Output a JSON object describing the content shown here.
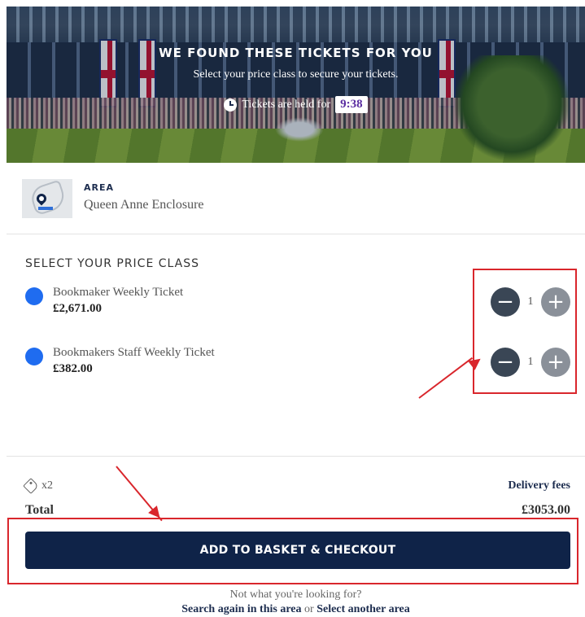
{
  "hero": {
    "title": "WE FOUND THESE TICKETS FOR YOU",
    "subtitle": "Select your price class to secure your tickets.",
    "hold_text": "Tickets are held for",
    "timer": "9:38"
  },
  "area": {
    "label": "AREA",
    "name": "Queen Anne Enclosure",
    "map_icon": "map-pin-icon"
  },
  "price_section": {
    "title": "SELECT YOUR PRICE CLASS",
    "items": [
      {
        "name": "Bookmaker Weekly Ticket",
        "price": "£2,671.00",
        "quantity": "1"
      },
      {
        "name": "Bookmakers Staff Weekly Ticket",
        "price": "£382.00",
        "quantity": "1"
      }
    ],
    "minus_symbol": "−",
    "plus_symbol": "+"
  },
  "totals": {
    "ticket_count": "x2",
    "delivery_link": "Delivery fees",
    "total_label": "Total",
    "total_value": "£3053.00",
    "checkout_label": "ADD TO BASKET & CHECKOUT"
  },
  "footer": {
    "question": "Not what you're looking for?",
    "search_again": "Search again in this area",
    "or": "or",
    "select_another": "Select another area"
  },
  "colors": {
    "navy": "#0f2348",
    "radio_blue": "#1f6cf0",
    "annotation_red": "#d9262c",
    "timer_purple": "#5a2ca0"
  }
}
